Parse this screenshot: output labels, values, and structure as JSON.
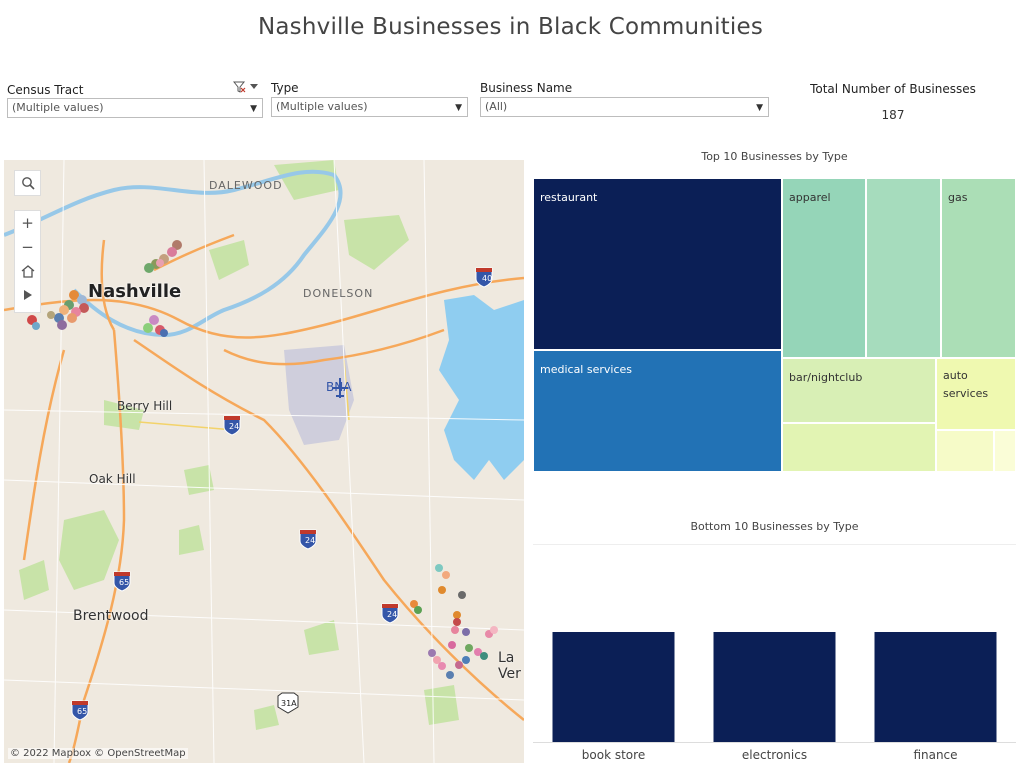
{
  "title": "Nashville Businesses in Black Communities",
  "filters": {
    "census_tract": {
      "label": "Census Tract",
      "value": "(Multiple values)"
    },
    "type": {
      "label": "Type",
      "value": "(Multiple values)"
    },
    "business_name": {
      "label": "Business Name",
      "value": "(All)"
    }
  },
  "total": {
    "label": "Total Number of Businesses",
    "value": "187"
  },
  "map": {
    "labels": {
      "dalewood": "DALEWOOD",
      "nashville": "Nashville",
      "donelson": "DONELSON",
      "bna": "BNA",
      "berry_hill": "Berry Hill",
      "oak_hill": "Oak Hill",
      "brentwood": "Brentwood",
      "la_vergne": "La Ver"
    },
    "shields": {
      "i40": "40",
      "i24a": "24",
      "i24b": "24",
      "i24c": "24",
      "i65a": "65",
      "i65b": "65",
      "us31a": "31A"
    },
    "attribution": "© 2022 Mapbox  © OpenStreetMap",
    "controls": [
      "search-icon",
      "zoom-in-icon",
      "zoom-out-icon",
      "home-icon",
      "play-icon"
    ]
  },
  "treemap": {
    "title": "Top 10 Businesses by Type",
    "tiles": [
      {
        "label": "restaurant",
        "color": "#0b1f56"
      },
      {
        "label": "medical services",
        "color": "#2272b5"
      },
      {
        "label": "apparel",
        "color": "#95d5b8"
      },
      {
        "label": "",
        "color": "#a6dcbd"
      },
      {
        "label": "gas",
        "color": "#abdeb6"
      },
      {
        "label": "bar/nightclub",
        "color": "#d8efb5"
      },
      {
        "label": "",
        "color": "#e2f4b3"
      },
      {
        "label": "auto services",
        "color": "#eff9b0"
      },
      {
        "label": "",
        "color": "#f6fbc8"
      },
      {
        "label": "",
        "color": "#fafdd7"
      }
    ]
  },
  "chart_data": {
    "type": "bar",
    "title": "Bottom 10 Businesses by Type",
    "categories": [
      "book store",
      "electronics",
      "finance"
    ],
    "values": [
      1,
      1,
      1
    ],
    "ylim": [
      0,
      1.8
    ],
    "color": "#0b1f56",
    "xlabel": "",
    "ylabel": ""
  }
}
